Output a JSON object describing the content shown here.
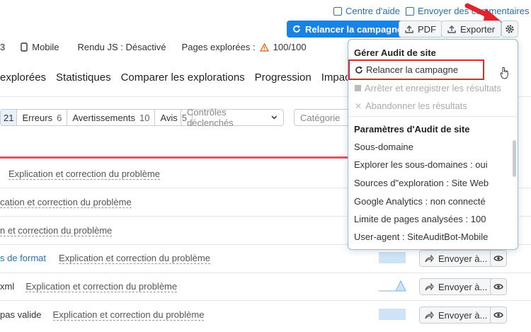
{
  "header": {
    "help_label": "Centre d'aide",
    "comments_label": "Envoyer des commentaires"
  },
  "toolbar": {
    "relaunch_label": "Relancer la campagne",
    "pdf_label": "PDF",
    "export_label": "Exporter"
  },
  "info": {
    "devices_count": "3",
    "device_label": "Mobile",
    "js_render": "Rendu JS : Désactivé",
    "pages_label": "Pages explorées :",
    "pages_value": "100/100"
  },
  "nav": {
    "tabs": [
      "explorées",
      "Statistiques",
      "Comparer les explorations",
      "Progression",
      "Impact JS"
    ]
  },
  "filters": {
    "all_count": "21",
    "errors_label": "Erreurs",
    "errors_count": "6",
    "warnings_label": "Avertissements",
    "warnings_count": "10",
    "notices_label": "Avis",
    "notices_count": "5",
    "checks_placeholder": "Contrôles déclenchés",
    "category_placeholder": "Catégorie"
  },
  "rows": [
    {
      "prefix": "",
      "expl": "Explication et correction du problème"
    },
    {
      "prefix": "",
      "expl": "cation et correction du problème"
    },
    {
      "prefix": "",
      "expl": "n et correction du problème"
    },
    {
      "prefix": "s de format",
      "expl": "Explication et correction du problème",
      "send": "Envoyer à..."
    },
    {
      "prefix": "xml",
      "expl": "Explication et correction du problème",
      "send": "Envoyer à..."
    },
    {
      "prefix": "pas valide",
      "expl": "Explication et correction du problème",
      "send": "Envoyer à..."
    }
  ],
  "menu": {
    "heading1": "Gérer Audit de site",
    "relaunch": "Relancer la campagne",
    "stop": "Arrêter et enregistrer les résultats",
    "abandon": "Abandonner les résultats",
    "heading2": "Paramètres d'Audit de site",
    "items": [
      "Sous-domaine",
      "Explorer les sous-domaines : oui",
      "Sources d\"exploration : Site Web",
      "Google Analytics : non connecté",
      "Limite de pages analysées : 100",
      "User-agent : SiteAuditBot-Mobile"
    ]
  },
  "colors": {
    "accent": "#1a82e2",
    "error_line": "#e05563",
    "annotation_red": "#d32f2f"
  }
}
